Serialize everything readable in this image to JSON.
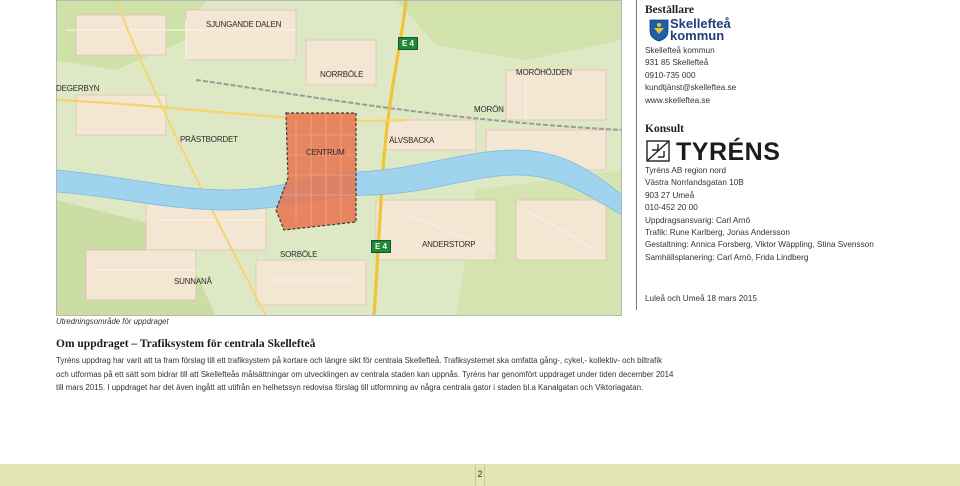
{
  "map": {
    "labels": {
      "sjungande_dalen": "SJUNGANDE DALEN",
      "degerbyn": "DEGERBYN",
      "norrbole": "NORRBÖLE",
      "morohojden": "MORÖHÖJDEN",
      "moron": "MORÖN",
      "prastbordet": "PRÄSTBORDET",
      "centrum": "CENTRUM",
      "alvsbacka": "ÄLVSBACKA",
      "sorbole": "SORBÖLE",
      "anderstorp": "ANDERSTORP",
      "sunnana": "SUNNANÅ"
    },
    "road_shield_1": "E 4",
    "road_shield_2": "E 4",
    "caption": "Utredningsområde för uppdraget"
  },
  "bestallare": {
    "heading": "Beställare",
    "logo_line1": "Skellefteå",
    "logo_line2": "kommun",
    "lines": [
      "Skellefteå kommun",
      "931 85 Skellefteå",
      "0910-735 000",
      "kundtjänst@skelleftea.se",
      "www.skelleftea.se"
    ]
  },
  "konsult": {
    "heading": "Konsult",
    "logo_text": "TYRÉNS",
    "lines": [
      "Tyréns AB region nord",
      "Västra Norrlandsgatan 10B",
      "903 27 Umeå",
      "010-452 20 00",
      "Uppdragsansvarig: Carl Arnö",
      "Trafik: Rune Karlberg, Jonas Andersson",
      "Gestaltning: Annica Forsberg, Viktor Wäppling, Stina Svensson",
      "Samhällsplanering: Carl Arnö, Frida Lindberg"
    ],
    "date": "Luleå och Umeå 18 mars 2015"
  },
  "about": {
    "heading": "Om uppdraget – Trafiksystem för centrala Skellefteå",
    "lines": [
      "Tyréns uppdrag har varit att ta fram förslag till ett trafiksystem på kortare och längre sikt för centrala Skellefteå. Trafiksystemet ska omfatta gång-, cykel,- kollektiv- och biltrafik",
      "och utformas på ett sätt som bidrar till att Skellefteås målsättningar om utvecklingen av centrala staden kan uppnås. Tyréns har genomfört uppdraget under tiden december 2014",
      "till mars 2015. I uppdraget har det även ingått att utifrån en helhetssyn redovisa förslag till utformning av några centrala gator i staden bl.a Kanalgatan och Viktoriagatan."
    ]
  },
  "footer": {
    "page_number": "2"
  },
  "colors": {
    "map_land": "#dfe8c4",
    "river": "#9fd3ee",
    "study_area": "#e8734f",
    "footer_band": "#e4e6b5",
    "road_shield": "#1f8a3a"
  }
}
